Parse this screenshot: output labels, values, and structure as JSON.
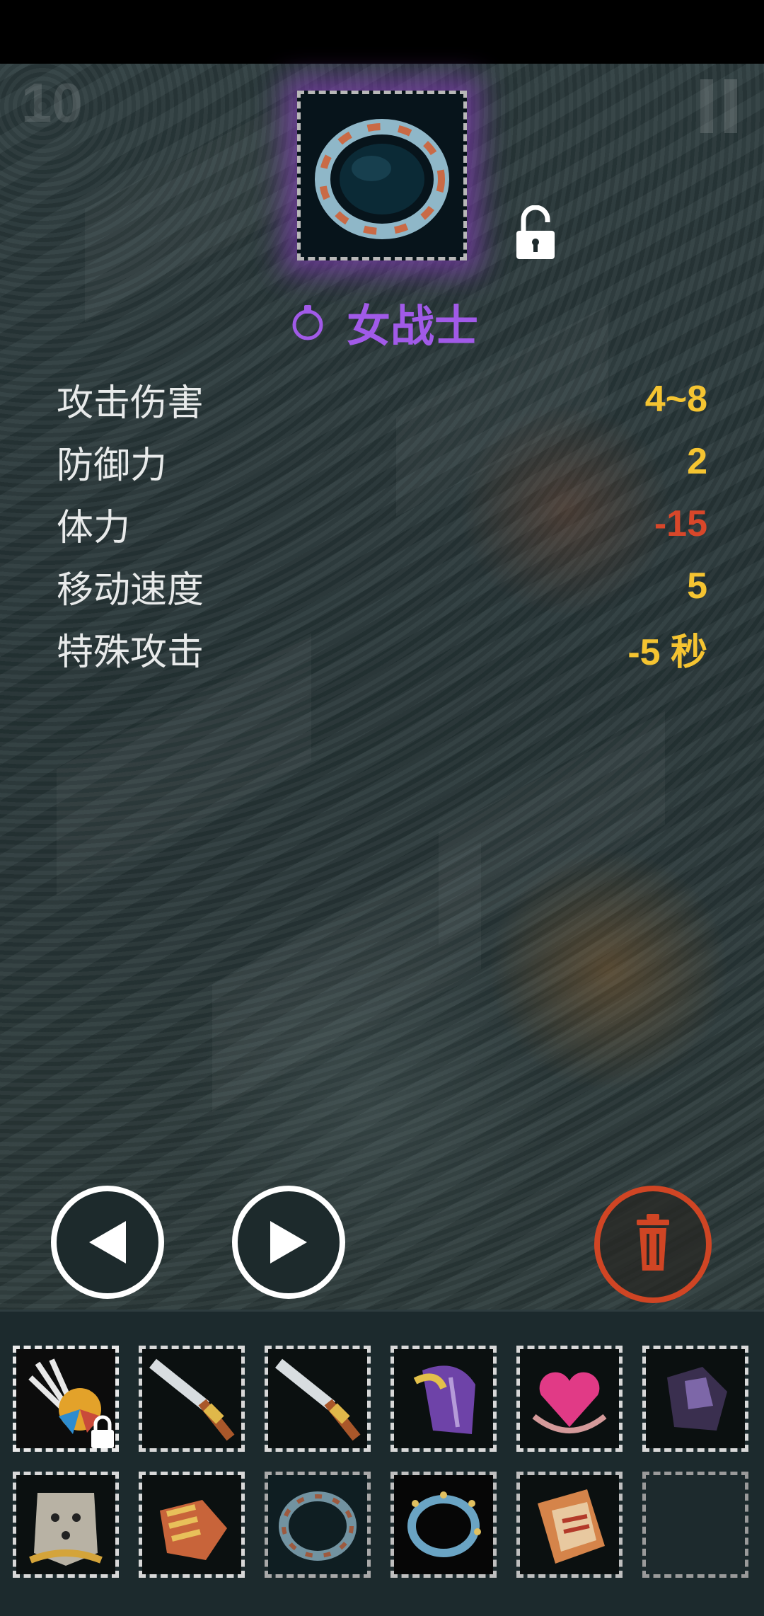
{
  "hud": {
    "level": "10"
  },
  "item": {
    "name": "女战士",
    "colors": {
      "name": "#a15ae8",
      "glow": "#9a3ce0"
    }
  },
  "stats": [
    {
      "label": "攻击伤害",
      "value": "4~8",
      "color": "#f5c431"
    },
    {
      "label": "防御力",
      "value": "2",
      "color": "#f5c431"
    },
    {
      "label": "体力",
      "value": "-15",
      "color": "#d8472a"
    },
    {
      "label": "移动速度",
      "value": "5",
      "color": "#f5c431"
    },
    {
      "label": "特殊攻击",
      "value": "-5 秒",
      "color": "#f5c431"
    }
  ],
  "buttons": {
    "prev_icon": "triangle-left-icon",
    "next_icon": "triangle-right-icon",
    "trash_icon": "trash-icon",
    "trash_color": "#d04524"
  },
  "inventory": {
    "rows": [
      [
        {
          "icon": "feather-fan-icon",
          "locked": true
        },
        {
          "icon": "spear-icon",
          "locked": false
        },
        {
          "icon": "spear-icon",
          "locked": false
        },
        {
          "icon": "purple-gauntlet-icon",
          "locked": false
        },
        {
          "icon": "heart-amulet-icon",
          "locked": false
        },
        {
          "icon": "dark-crystal-icon",
          "locked": false
        }
      ],
      [
        {
          "icon": "stone-mask-icon",
          "locked": false
        },
        {
          "icon": "fist-gauntlet-icon",
          "locked": false
        },
        {
          "icon": "ring-icon",
          "locked": false,
          "selected": true
        },
        {
          "icon": "spiked-ring-icon",
          "locked": false
        },
        {
          "icon": "talisman-tag-icon",
          "locked": false
        },
        {
          "icon": "empty-slot",
          "locked": false
        }
      ]
    ]
  }
}
